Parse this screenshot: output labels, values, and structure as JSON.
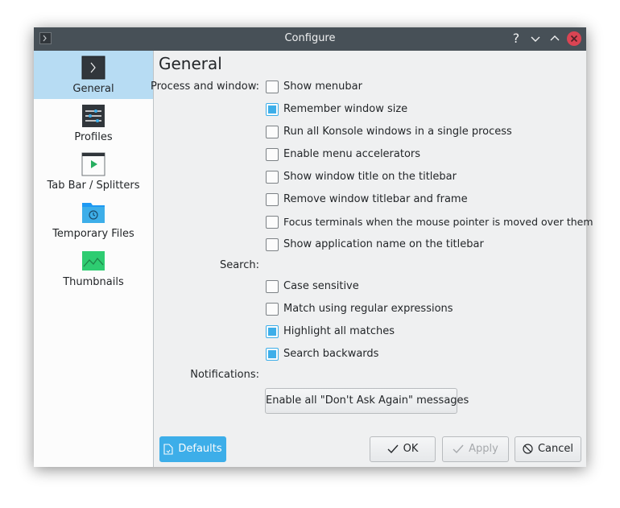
{
  "window": {
    "title": "Configure"
  },
  "titlebar": {
    "icons": [
      "terminal-icon",
      "help-icon",
      "minimize-icon",
      "maximize-icon",
      "close-icon"
    ],
    "help_glyph": "?"
  },
  "sidebar": {
    "items": [
      {
        "label": "General",
        "icon": "konsole-icon",
        "selected": true
      },
      {
        "label": "Profiles",
        "icon": "profiles-icon"
      },
      {
        "label": "Tab Bar / Splitters",
        "icon": "tabbar-icon"
      },
      {
        "label": "Temporary Files",
        "icon": "folder-icon"
      },
      {
        "label": "Thumbnails",
        "icon": "image-icon"
      }
    ]
  },
  "main": {
    "title": "General",
    "process_and_window": {
      "label": "Process and window:",
      "options": [
        {
          "label": "Show menubar",
          "checked": false
        },
        {
          "label": "Remember window size",
          "checked": true
        },
        {
          "label": "Run all Konsole windows in a single process",
          "checked": false
        },
        {
          "label": "Enable menu accelerators",
          "checked": false
        },
        {
          "label": "Show window title on the titlebar",
          "checked": false
        },
        {
          "label": "Remove window titlebar and frame",
          "checked": false
        },
        {
          "label": "Focus terminals when the mouse pointer is moved over them",
          "checked": false
        },
        {
          "label": "Show application name on the titlebar",
          "checked": false
        }
      ]
    },
    "search": {
      "label": "Search:",
      "options": [
        {
          "label": "Case sensitive",
          "checked": false
        },
        {
          "label": "Match using regular expressions",
          "checked": false
        },
        {
          "label": "Highlight all matches",
          "checked": true
        },
        {
          "label": "Search backwards",
          "checked": true
        }
      ]
    },
    "notifications": {
      "label": "Notifications:",
      "button": "Enable all \"Don't Ask Again\" messages"
    }
  },
  "footer": {
    "defaults": "Defaults",
    "ok": "OK",
    "apply": "Apply",
    "cancel": "Cancel"
  },
  "colors": {
    "accent": "#3daee9",
    "titlebar": "#475057",
    "selection": "#b7dcf3",
    "close": "#da4453"
  }
}
